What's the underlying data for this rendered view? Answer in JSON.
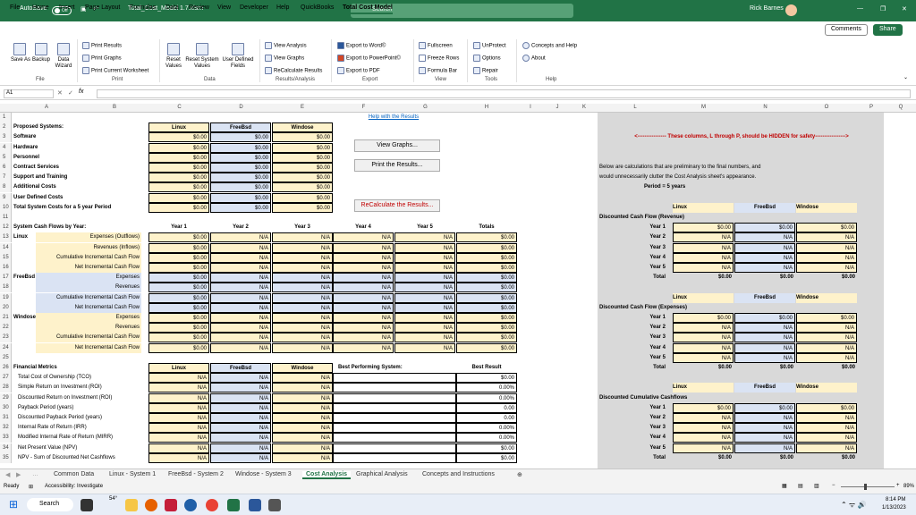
{
  "titlebar": {
    "autosave": "AutoSave",
    "toggle": "Off",
    "filename": "Total_Cost_Model 1.7.xlsm",
    "search_placeholder": "Search",
    "user": "Rick Barnes"
  },
  "menu": {
    "tabs": [
      "File",
      "Home",
      "Insert",
      "Page Layout",
      "Formulas",
      "Data",
      "Review",
      "View",
      "Developer",
      "Help",
      "QuickBooks",
      "Total Cost Model"
    ],
    "comments": "Comments",
    "share": "Share"
  },
  "ribbon": {
    "file": {
      "save_as": "Save As",
      "backup": "Backup",
      "data_wizard": "Data Wizard",
      "label": "File"
    },
    "print": {
      "results": "Print Results",
      "graphs": "Print Graphs",
      "current": "Print Current Worksheet",
      "label": "Print"
    },
    "data": {
      "reset_values": "Reset Values",
      "reset_system": "Reset System Values",
      "user_defined": "User Defined Fields",
      "label": "Data"
    },
    "results": {
      "view_analysis": "View Analysis",
      "view_graphs": "View Graphs",
      "recalc": "ReCalculate Results",
      "label": "Results/Analysis"
    },
    "export": {
      "word": "Export to Word©",
      "ppt": "Export to PowerPoint©",
      "pdf": "Export to PDF",
      "label": "Export"
    },
    "view": {
      "fullscreen": "Fullscreen",
      "freeze": "Freeze Rows",
      "formula_bar": "Formula Bar",
      "label": "View"
    },
    "tools": {
      "unprotect": "UnProtect",
      "options": "Options",
      "repair": "Repair",
      "label": "Tools"
    },
    "help": {
      "concepts": "Concepts and Help",
      "about": "About",
      "label": "Help"
    }
  },
  "formula": {
    "namebox": "A1",
    "fx": "fx",
    "value": ""
  },
  "columns": [
    "A",
    "B",
    "C",
    "D",
    "E",
    "F",
    "G",
    "H",
    "I",
    "J",
    "K",
    "L",
    "M",
    "N",
    "O",
    "P",
    "Q"
  ],
  "rows": [
    "1",
    "2",
    "3",
    "4",
    "5",
    "6",
    "7",
    "8",
    "9",
    "10",
    "11",
    "12",
    "13",
    "14",
    "15",
    "16",
    "17",
    "18",
    "19",
    "20",
    "21",
    "22",
    "23",
    "24",
    "25",
    "26",
    "27",
    "28",
    "29",
    "30",
    "31",
    "32",
    "33",
    "34",
    "35"
  ],
  "sheet": {
    "help_link": "Help with the Results",
    "view_graphs_btn": "View Graphs...",
    "print_btn": "Print the Results...",
    "recalc_btn": "ReCalculate the Results...",
    "proposed": "Proposed Systems:",
    "systems": [
      "Linux",
      "FreeBsd",
      "Windose"
    ],
    "cost_rows": [
      "Software",
      "Hardware",
      "Personnel",
      "Contract Services",
      "Support and Training",
      "Additional Costs",
      "User Defined Costs",
      "Total System Costs for a 5 year Period"
    ],
    "zero": "$0.00",
    "na": "N/A",
    "cf_title": "System Cash Flows by Year:",
    "years": [
      "Year 1",
      "Year 2",
      "Year 3",
      "Year 4",
      "Year 5",
      "Totals"
    ],
    "linux_rows": [
      "Expenses (Outflows)",
      "Revenues (Inflows)",
      "Cumulative Incremental Cash Flow",
      "Net Incremental Cash Flow"
    ],
    "other_rows": [
      "Expenses",
      "Revenues",
      "Cumulative Incremental Cash Flow",
      "Net Incremental Cash Flow"
    ],
    "fm_title": "Financial Metrics",
    "best_title": "Best Performing System:",
    "best_result": "Best Result",
    "metrics": [
      "Total Cost of Ownership (TCO)",
      "Simple Return on Investment (ROI)",
      "Discounted Return on Investment (ROI)",
      "Payback Period (years)",
      "Discounted Payback Period (years)",
      "Internal Rate of Return (IRR)",
      "Modified Internal Rate of Return (MIRR)",
      "Net Present Value (NPV)",
      "NPV - Sum of Discounted Net Cashflows"
    ],
    "best_values": [
      "$0.00",
      "0.00%",
      "0.00%",
      "0.00",
      "0.00",
      "0.00%",
      "0.00%",
      "$0.00",
      "$0.00"
    ],
    "hidden_note": "<---------------- These columns, L through P, should be HIDDEN for safety----------------->",
    "calc_note1": "Below are calculations that are preliminary to the final numbers, and",
    "calc_note2": "would unnecessarily clutter the Cost Analysis sheet's appearance.",
    "period": "Period = 5 years",
    "dcf_rev": "Discounted Cash Flow (Revenue)",
    "dcf_exp": "Discounted Cash Flow (Expenses)",
    "dcf_cum": "Discounted Cumulative Cashflows",
    "year_labels": [
      "Year 1",
      "Year 2",
      "Year 3",
      "Year 4",
      "Year 5",
      "Total"
    ]
  },
  "sheet_tabs": [
    "Common Data",
    "Linux - System 1",
    "FreeBsd - System 2",
    "Windose - System 3",
    "Cost Analysis",
    "Graphical Analysis",
    "Concepts and Instructions"
  ],
  "status": {
    "ready": "Ready",
    "accessibility": "Accessibility: Investigate",
    "zoom": "89%"
  },
  "taskbar": {
    "search": "Search",
    "weather": "54°",
    "time": "8:14 PM",
    "date": "1/13/2023"
  }
}
